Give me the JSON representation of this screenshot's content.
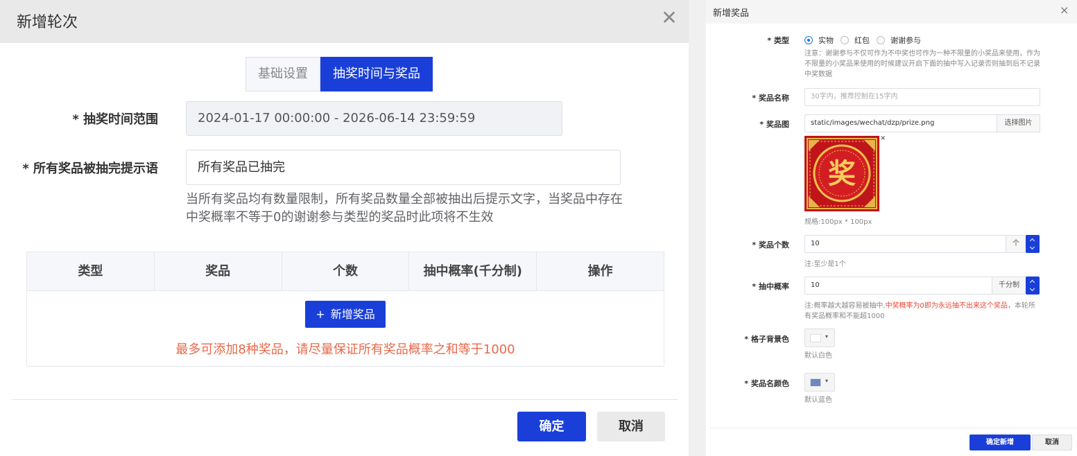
{
  "left_dialog": {
    "title": "新增轮次",
    "close_glyph": "✕",
    "tabs": [
      {
        "label": "基础设置",
        "active": false
      },
      {
        "label": "抽奖时间与奖品",
        "active": true
      }
    ],
    "time_range": {
      "label": "* 抽奖时间范围",
      "value": "2024-01-17 00:00:00 - 2026-06-14 23:59:59"
    },
    "all_drawn_tip": {
      "label": "* 所有奖品被抽完提示语",
      "value": "所有奖品已抽完",
      "help": "当所有奖品均有数量限制，所有奖品数量全部被抽出后提示文字，当奖品中存在中奖概率不等于0的谢谢参与类型的奖品时此项将不生效"
    },
    "prize_table": {
      "columns": [
        "类型",
        "奖品",
        "个数",
        "抽中概率(千分制)",
        "操作"
      ],
      "add_button": "新增奖品",
      "add_icon": "+",
      "warning": "最多可添加8种奖品，请尽量保证所有奖品概率之和等于1000"
    },
    "buttons": {
      "ok": "确定",
      "cancel": "取消"
    }
  },
  "right_dialog": {
    "title": "新增奖品",
    "close_glyph": "×",
    "type": {
      "label": "* 类型",
      "options": [
        "实物",
        "红包",
        "谢谢参与"
      ],
      "selected": "实物",
      "note": "注意：谢谢参与不仅可作为不中奖也可作为一种不限量的小奖品来使用，作为不限量的小奖品来使用的时候建议开启下面的抽中写入记录否则抽到后不记录中奖数据"
    },
    "prize_name": {
      "label": "* 奖品名称",
      "placeholder": "30字内，推荐控制在15字内"
    },
    "prize_image": {
      "label": "* 奖品图",
      "path": "static/images/wechat/dzp/prize.png",
      "select_button": "选择图片",
      "image_char": "奖",
      "remove_glyph": "×",
      "spec": "规格:100px * 100px"
    },
    "prize_count": {
      "label": "* 奖品个数",
      "value": "10",
      "addon": "个",
      "note": "注:至少是1个"
    },
    "probability": {
      "label": "* 抽中概率",
      "value": "10",
      "addon": "千分制",
      "note_prefix": "注:概率越大越容易被抽中,",
      "note_red": "中奖概率为0即为永远抽不出来这个奖品",
      "note_suffix": "，本轮所有奖品概率和不能超1000"
    },
    "cell_bg": {
      "label": "* 格子背景色",
      "color": "#ffffff",
      "caption": "默认白色"
    },
    "name_color": {
      "label": "* 奖品名颜色",
      "color": "#6f86c0",
      "caption": "默认蓝色"
    },
    "buttons": {
      "ok": "确定新增",
      "cancel": "取消"
    }
  }
}
